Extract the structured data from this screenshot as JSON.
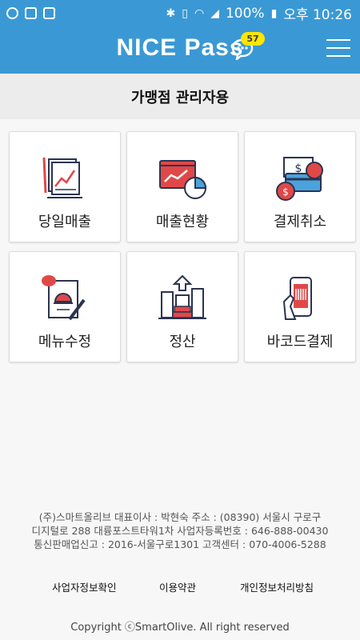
{
  "status_bar": {
    "battery": "100%",
    "time": "오후 10:26"
  },
  "header": {
    "title": "NICE Pass",
    "badge_count": "57"
  },
  "subtitle": "가맹점 관리자용",
  "tiles": [
    {
      "label": "당일매출",
      "icon": "daily-sales-icon"
    },
    {
      "label": "매출현황",
      "icon": "sales-status-icon"
    },
    {
      "label": "결제취소",
      "icon": "payment-cancel-icon"
    },
    {
      "label": "메뉴수정",
      "icon": "menu-edit-icon"
    },
    {
      "label": "정산",
      "icon": "settlement-icon"
    },
    {
      "label": "바코드결제",
      "icon": "barcode-payment-icon"
    }
  ],
  "footer": {
    "company_lines": [
      "(주)스마트올리브 대표이사 : 박현숙 주소 : (08390) 서울시 구로구",
      "디지털로 288 대륭포스트타워1차 사업자등록번호 : 646-888-00430",
      "통신판매업신고 : 2016-서울구로1301 고객센터 : 070-4006-5288"
    ],
    "links": [
      "사업자정보확인",
      "이용약관",
      "개인정보처리방침"
    ],
    "copyright": "Copyright ⓒSmartOlive. All right reserved"
  },
  "colors": {
    "brand": "#3a99d4",
    "badge": "#ffe600",
    "icon_red": "#e04848",
    "icon_navy": "#2b3450"
  }
}
